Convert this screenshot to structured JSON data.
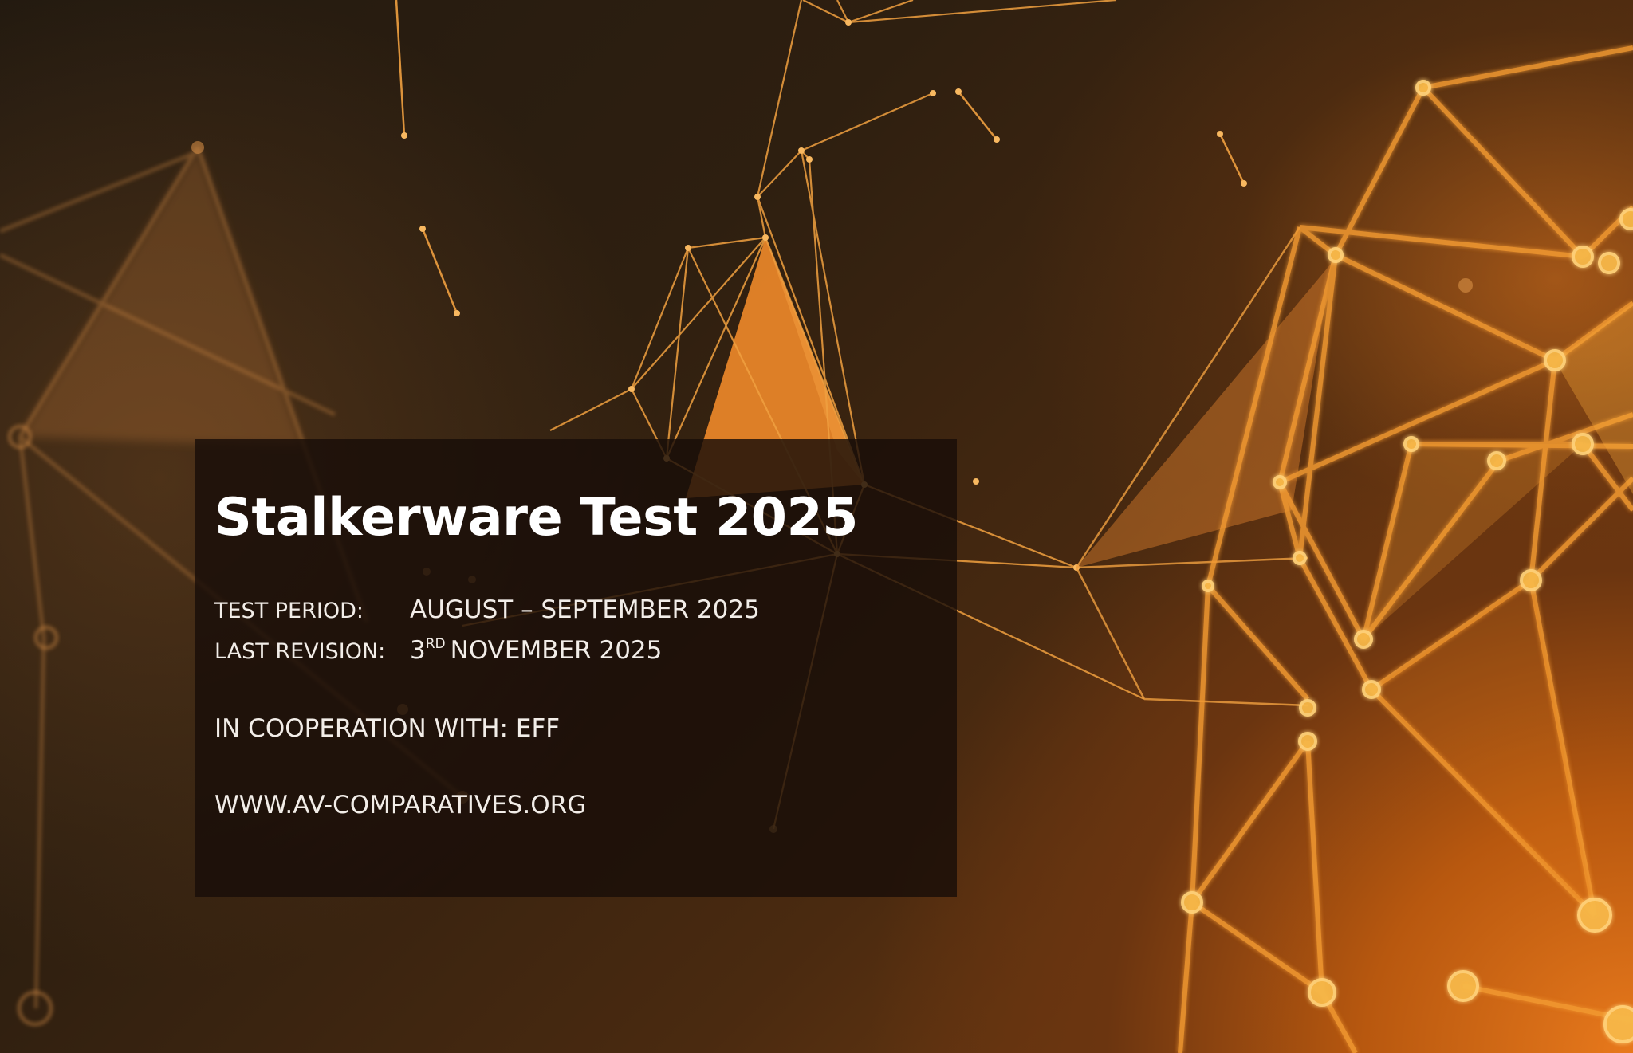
{
  "document": {
    "title": "Stalkerware Test 2025",
    "test_period_label": "TEST PERIOD:",
    "test_period_value": "AUGUST – SEPTEMBER 2025",
    "last_revision_label": "LAST REVISION:",
    "last_revision_day": "3",
    "last_revision_suffix": "RD",
    "last_revision_rest": "NOVEMBER 2025",
    "cooperation": "IN COOPERATION WITH: EFF",
    "website": "WWW.AV-COMPARATIVES.ORG"
  },
  "colors": {
    "accent_orange": "#f0901e",
    "panel_background": "#180e08",
    "text": "#ffffff"
  }
}
